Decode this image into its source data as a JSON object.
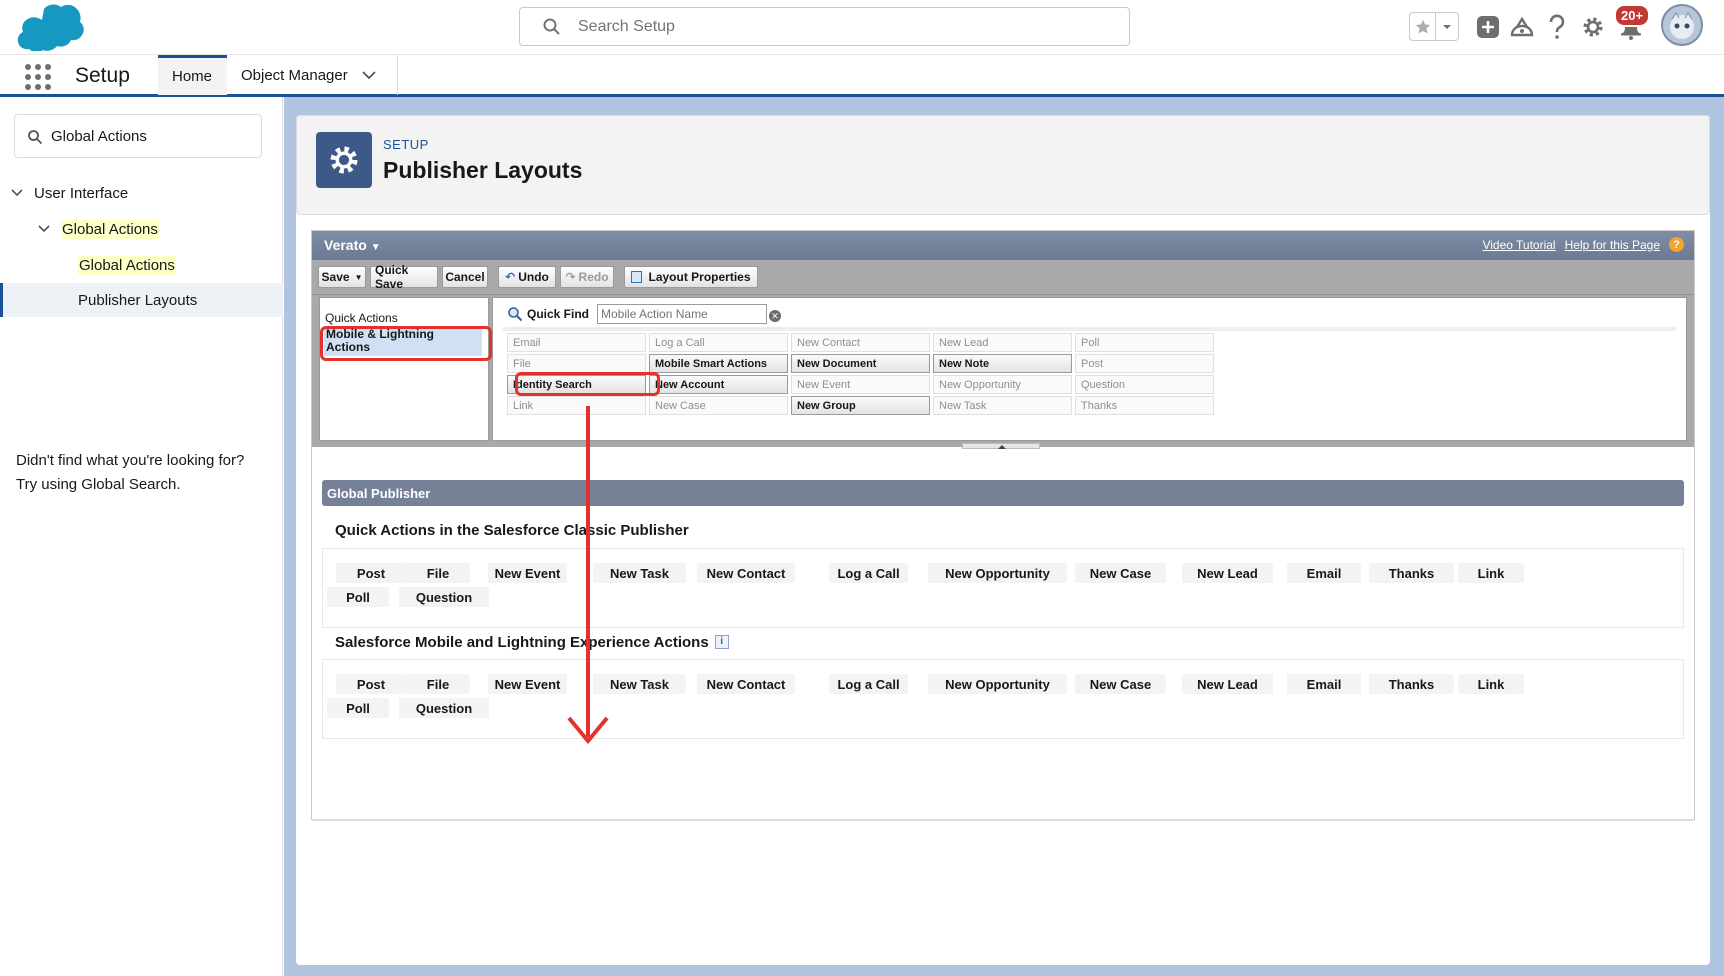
{
  "header": {
    "search_placeholder": "Search Setup",
    "notification_count": "20+",
    "icons": [
      "salesforce-cloud-logo",
      "star-icon",
      "chevron-down-icon",
      "plus-icon",
      "trailhead-icon",
      "help-icon",
      "gear-icon",
      "bell-icon",
      "avatar"
    ]
  },
  "nav": {
    "app_name": "Setup",
    "tabs": [
      {
        "label": "Home",
        "active": true
      },
      {
        "label": "Object Manager",
        "active": false
      }
    ]
  },
  "sidebar": {
    "search_value": "Global Actions",
    "tree": {
      "user_interface": "User Interface",
      "global_actions_group": "Global Actions",
      "global_actions_item": "Global Actions",
      "publisher_layouts": "Publisher Layouts"
    },
    "notfound_line1": "Didn't find what you're looking for?",
    "notfound_line2": "Try using Global Search."
  },
  "page": {
    "eyebrow": "SETUP",
    "title": "Publisher Layouts"
  },
  "editor": {
    "layout_name": "Verato",
    "video_tutorial": "Video Tutorial",
    "help_link": "Help for this Page",
    "help_glyph": "?",
    "toolbar": {
      "save": "Save",
      "quick_save": "Quick Save",
      "cancel": "Cancel",
      "undo": "Undo",
      "redo": "Redo",
      "layout_properties": "Layout Properties"
    },
    "palette": {
      "quick_actions": "Quick Actions",
      "mobile_lightning": "Mobile & Lightning Actions",
      "quick_find_label": "Quick Find",
      "quick_find_placeholder": "Mobile Action Name",
      "items": [
        {
          "label": "Email",
          "used": false
        },
        {
          "label": "Log a Call",
          "used": false
        },
        {
          "label": "New Contact",
          "used": false
        },
        {
          "label": "New Lead",
          "used": false
        },
        {
          "label": "Poll",
          "used": false
        },
        {
          "label": "File",
          "used": false
        },
        {
          "label": "Mobile Smart Actions",
          "used": true
        },
        {
          "label": "New Document",
          "used": true
        },
        {
          "label": "New Note",
          "used": true
        },
        {
          "label": "Post",
          "used": false
        },
        {
          "label": "Identity Search",
          "used": true
        },
        {
          "label": "New Account",
          "used": true
        },
        {
          "label": "New Event",
          "used": false
        },
        {
          "label": "New Opportunity",
          "used": false
        },
        {
          "label": "Question",
          "used": false
        },
        {
          "label": "Link",
          "used": false
        },
        {
          "label": "New Case",
          "used": false
        },
        {
          "label": "New Group",
          "used": true
        },
        {
          "label": "New Task",
          "used": false
        },
        {
          "label": "Thanks",
          "used": false
        }
      ]
    },
    "global_publisher": "Global Publisher",
    "classic_title": "Quick Actions in the Salesforce Classic Publisher",
    "mobile_title": "Salesforce Mobile and Lightning Experience Actions",
    "info_glyph": "i",
    "actions_row1": [
      "Post",
      "File",
      "New Event",
      "New Task",
      "New Contact",
      "Log a Call",
      "New Opportunity",
      "New Case",
      "New Lead",
      "Email",
      "Thanks",
      "Link"
    ],
    "actions_row2": [
      "Poll",
      "Question"
    ]
  },
  "colors": {
    "brand": "#1b5297",
    "header_bar": "#768198",
    "annotation": "#e3312d",
    "highlight": "#ffffc8"
  }
}
